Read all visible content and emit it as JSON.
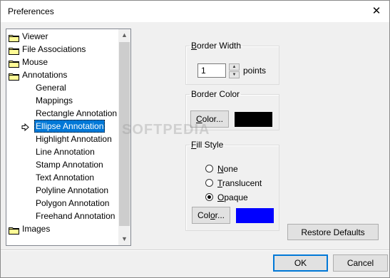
{
  "window": {
    "title": "Preferences"
  },
  "tree": {
    "items": [
      {
        "label": "Viewer",
        "level": 0,
        "icon": "folder-icon"
      },
      {
        "label": "File Associations",
        "level": 0,
        "icon": "folder-icon"
      },
      {
        "label": "Mouse",
        "level": 0,
        "icon": "folder-icon"
      },
      {
        "label": "Annotations",
        "level": 0,
        "icon": "folder-icon"
      },
      {
        "label": "General",
        "level": 1
      },
      {
        "label": "Mappings",
        "level": 1
      },
      {
        "label": "Rectangle Annotation",
        "level": 1
      },
      {
        "label": "Ellipse Annotation",
        "level": 1,
        "selected": true,
        "icon": "arrow-icon"
      },
      {
        "label": "Highlight Annotation",
        "level": 1
      },
      {
        "label": "Line Annotation",
        "level": 1
      },
      {
        "label": "Stamp Annotation",
        "level": 1
      },
      {
        "label": "Text Annotation",
        "level": 1
      },
      {
        "label": "Polyline Annotation",
        "level": 1
      },
      {
        "label": "Polygon Annotation",
        "level": 1
      },
      {
        "label": "Freehand Annotation",
        "level": 1
      },
      {
        "label": "Images",
        "level": 0,
        "icon": "folder-icon"
      }
    ]
  },
  "border_width": {
    "legend_mnemonic": "B",
    "legend_rest": "order Width",
    "value": "1",
    "unit": "points"
  },
  "border_color": {
    "legend": "Border Color",
    "button_mnemonic": "C",
    "button_rest": "olor...",
    "swatch_color": "#000000"
  },
  "fill_style": {
    "legend_mnemonic": "F",
    "legend_rest": "ill Style",
    "options": [
      {
        "mnemonic": "N",
        "rest": "one",
        "checked": false
      },
      {
        "mnemonic": "T",
        "rest": "ranslucent",
        "checked": false
      },
      {
        "mnemonic": "O",
        "rest": "paque",
        "checked": true
      }
    ],
    "button_pre": "Col",
    "button_mnemonic": "o",
    "button_rest": "r...",
    "swatch_color": "#0000ff"
  },
  "buttons": {
    "restore_defaults": "Restore Defaults",
    "ok": "OK",
    "cancel": "Cancel"
  },
  "watermark": "SOFTPEDIA"
}
